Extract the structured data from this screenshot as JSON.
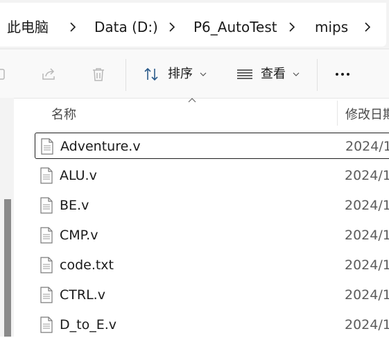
{
  "breadcrumb": {
    "items": [
      {
        "label": "此电脑"
      },
      {
        "label": "Data (D:)"
      },
      {
        "label": "P6_AutoTest"
      },
      {
        "label": "mips"
      }
    ]
  },
  "toolbar": {
    "sort_label": "排序",
    "view_label": "查看",
    "more_label": "···"
  },
  "columns": {
    "name": "名称",
    "date": "修改日期"
  },
  "files": [
    {
      "name": "Adventure.v",
      "date": "2024/1"
    },
    {
      "name": "ALU.v",
      "date": "2024/1"
    },
    {
      "name": "BE.v",
      "date": "2024/1"
    },
    {
      "name": "CMP.v",
      "date": "2024/1"
    },
    {
      "name": "code.txt",
      "date": "2024/1"
    },
    {
      "name": "CTRL.v",
      "date": "2024/1"
    },
    {
      "name": "D_to_E.v",
      "date": "2024/1"
    }
  ],
  "colors": {
    "accent": "#1f1f1f",
    "toolbar_bg": "#f9f9f9",
    "addr_bg": "#ffffff"
  }
}
